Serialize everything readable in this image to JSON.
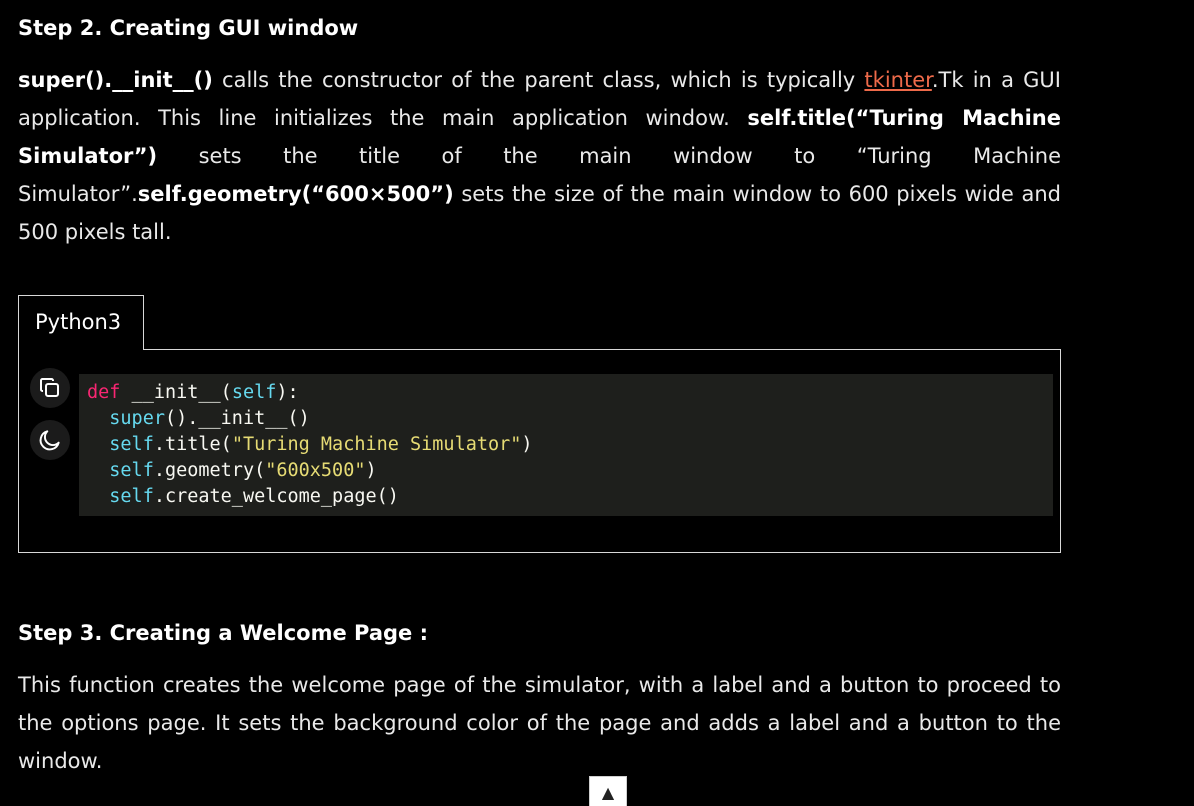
{
  "step2": {
    "heading": "Step 2. Creating GUI window",
    "p_bold1": "super().__init__()",
    "p_text1": " calls the constructor of the parent class, which is typically ",
    "p_link": "tkinter",
    "p_text2": ".Tk in a GUI application. This line initializes the main application window. ",
    "p_bold2": "self.title(“Turing Machine Simulator”)",
    "p_text3": " sets the title of the main window to “Turing Machine Simulator”.",
    "p_bold3": "self.geometry(“600×500”)",
    "p_text4": " sets the size of the main window to 600 pixels wide and 500 pixels tall."
  },
  "code_block": {
    "language_tab": "Python3",
    "line1_kw": "def",
    "line1_rest": " __init__(",
    "line1_self": "self",
    "line1_end": "):",
    "line2_indent": "  ",
    "line2_fn": "super",
    "line2_rest": "().__init__()",
    "line3_self": "self",
    "line3_rest": ".title(",
    "line3_str": "\"Turing Machine Simulator\"",
    "line3_end": ")",
    "line4_self": "self",
    "line4_rest": ".geometry(",
    "line4_str": "\"600x500\"",
    "line4_end": ")",
    "line5_self": "self",
    "line5_rest": ".create_welcome_page()"
  },
  "step3": {
    "heading": "Step 3. Creating a Welcome Page :",
    "paragraph": "This function creates the welcome page of the simulator, with a label and a button to proceed to the options page. It sets the background color of the page and adds a label and a button to the window."
  },
  "scroll_top": {
    "label": "▲"
  },
  "icons": {
    "copy": "copy-icon",
    "theme": "moon-icon"
  },
  "colors": {
    "background": "#000000",
    "link": "#ee6a4a",
    "keyword": "#f92672",
    "builtin": "#66d9ef",
    "string": "#e6db74",
    "code_bg": "#1e1f1c"
  }
}
